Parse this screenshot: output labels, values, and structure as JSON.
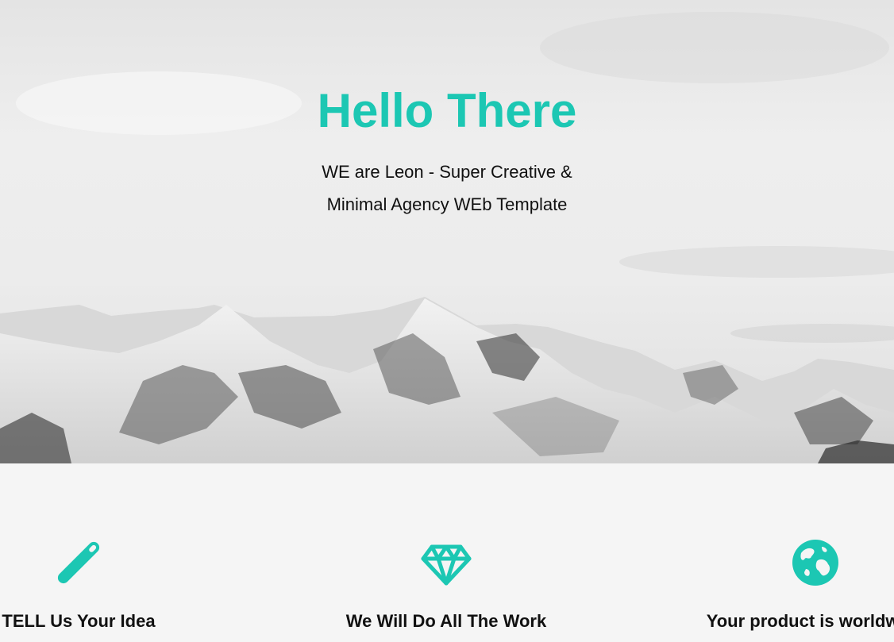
{
  "hero": {
    "title": "Hello There",
    "subtitle_line1": "WE are Leon - Super Creative &",
    "subtitle_line2": "Minimal Agency WEb Template"
  },
  "features": [
    {
      "icon": "pen-icon",
      "label": "TELL Us Your Idea"
    },
    {
      "icon": "diamond-icon",
      "label": "We Will Do All The Work"
    },
    {
      "icon": "globe-icon",
      "label": "Your product is worldwide"
    }
  ],
  "colors": {
    "accent": "#1cc7b3",
    "text": "#111111",
    "section_bg": "#f5f5f5"
  }
}
